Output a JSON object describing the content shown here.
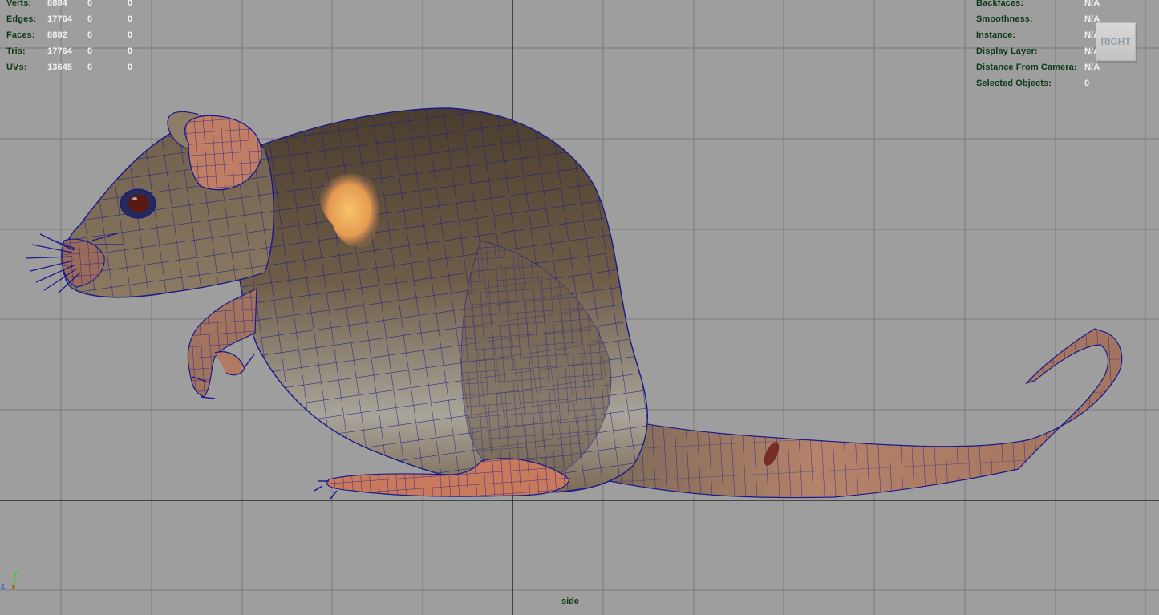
{
  "viewport": {
    "camera_name": "side",
    "view_cube_label": "RIGHT",
    "model": "rat"
  },
  "poly_count": [
    {
      "label": "Verts:",
      "v1": "8884",
      "v2": "0",
      "v3": "0"
    },
    {
      "label": "Edges:",
      "v1": "17764",
      "v2": "0",
      "v3": "0"
    },
    {
      "label": "Faces:",
      "v1": "8882",
      "v2": "0",
      "v3": "0"
    },
    {
      "label": "Tris:",
      "v1": "17764",
      "v2": "0",
      "v3": "0"
    },
    {
      "label": "UVs:",
      "v1": "13645",
      "v2": "0",
      "v3": "0"
    }
  ],
  "object_details": [
    {
      "label": "Backfaces:",
      "value": "N/A"
    },
    {
      "label": "Smoothness:",
      "value": "N/A"
    },
    {
      "label": "Instance:",
      "value": "N/A"
    },
    {
      "label": "Display Layer:",
      "value": "N/A"
    },
    {
      "label": "Distance From Camera:",
      "value": "N/A"
    },
    {
      "label": "Selected Objects:",
      "value": "0"
    }
  ],
  "axes": {
    "y": "y",
    "z": "z",
    "x": "x"
  },
  "colors": {
    "background": "#9e9e9e",
    "grid": "#7a7a7a",
    "hud_label": "#0d3a16",
    "hud_value": "#f2f2f2",
    "wireframe": "#1a1a8c",
    "fur": "#6e5a44"
  }
}
